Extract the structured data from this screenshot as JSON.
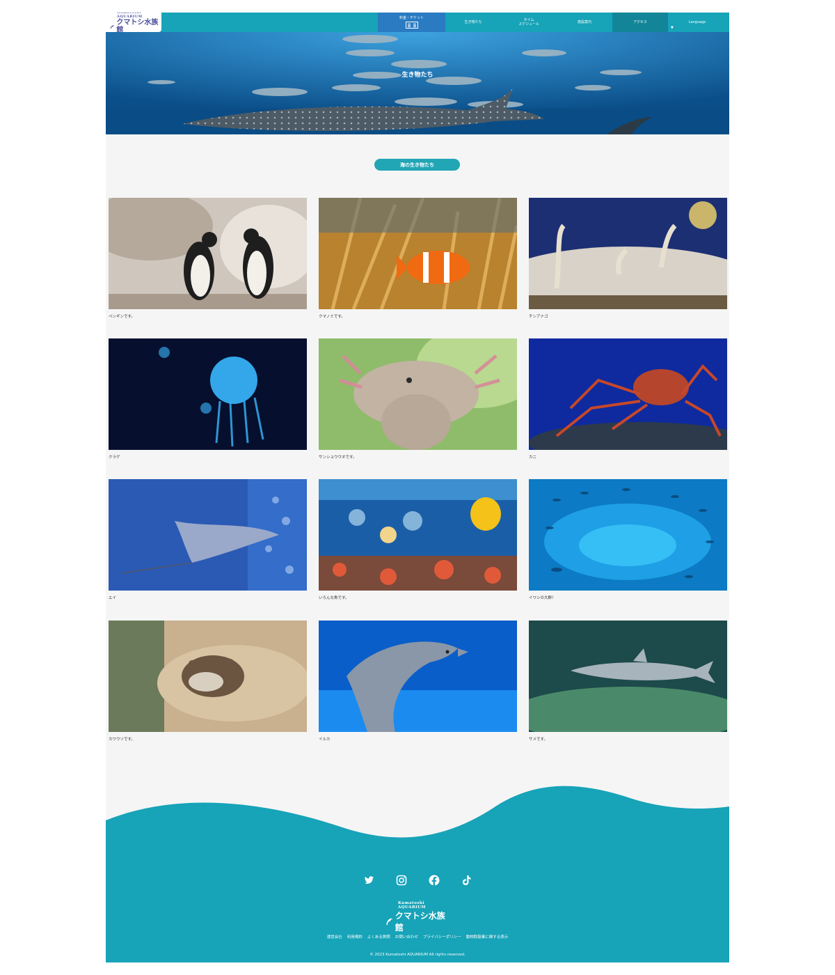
{
  "header": {
    "logo_en": "Kumatoshi  AQUARIUM",
    "logo_jp": "クマトシ水族館",
    "nav": [
      {
        "label": "料金・チケット"
      },
      {
        "label": "生き物たち"
      },
      {
        "label": "タイム\nスケジュール"
      },
      {
        "label": "施設案内"
      },
      {
        "label": "アクセス"
      },
      {
        "label": "Language"
      }
    ]
  },
  "hero": {
    "title": "生き物たち"
  },
  "section": {
    "title": "海の生き物たち"
  },
  "cards": [
    {
      "caption": "ペンギンです。"
    },
    {
      "caption": "クマノミです。"
    },
    {
      "caption": "チンアナゴ"
    },
    {
      "caption": "クラゲ"
    },
    {
      "caption": "サンショウウオです。"
    },
    {
      "caption": "カニ"
    },
    {
      "caption": "エイ"
    },
    {
      "caption": "いろんな魚です。"
    },
    {
      "caption": "イワシの大群！"
    },
    {
      "caption": "カワウソです。"
    },
    {
      "caption": "イルカ"
    },
    {
      "caption": "サメです。"
    }
  ],
  "footer": {
    "social": [
      "twitter-icon",
      "instagram-icon",
      "facebook-icon",
      "tiktok-icon"
    ],
    "logo_en": "Kumatoshi  AQUARIUM",
    "logo_jp": "クマトシ水族館",
    "links": [
      "運営会社",
      "利用規約",
      "よくある質問",
      "お問い合わせ",
      "プライバシーポリシー",
      "動物取扱業に関する表示"
    ],
    "copyright": "© 2023 Kumatoshi AQUARIUM All rights reserved."
  },
  "colors": {
    "primary": "#17a3b8",
    "nav_active": "#2a7bc2",
    "nav_dark": "#128598",
    "background": "#f5f5f5"
  }
}
